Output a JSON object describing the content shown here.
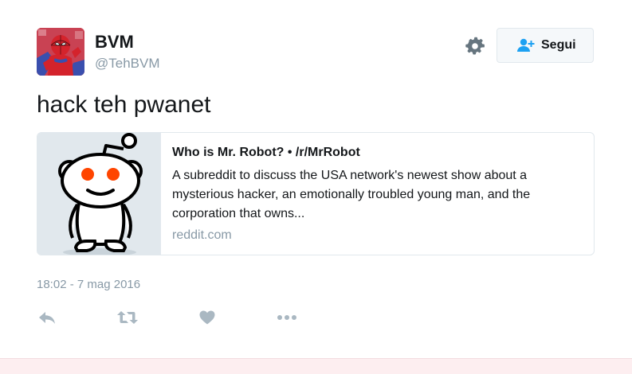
{
  "author": {
    "display_name": "BVM",
    "handle": "@TehBVM",
    "avatar_icon": "spiderman-avatar"
  },
  "header": {
    "settings_icon": "gear-icon",
    "follow_button": {
      "label": "Segui",
      "icon": "add-user-icon"
    }
  },
  "tweet": {
    "text": "hack teh pwanet",
    "timestamp": "18:02 - 7 mag 2016"
  },
  "card": {
    "image_icon": "reddit-alien-logo",
    "title": "Who is Mr. Robot? • /r/MrRobot",
    "description": "A subreddit to discuss the USA network's newest show about a mysterious hacker, an emotionally troubled young man, and the corporation that owns...",
    "domain": "reddit.com"
  },
  "actions": {
    "reply_icon": "reply-icon",
    "retweet_icon": "retweet-icon",
    "like_icon": "heart-icon",
    "more_icon": "more-dots-icon"
  },
  "colors": {
    "text_primary": "#14171a",
    "text_secondary": "#8899a6",
    "accent": "#1da1f2",
    "icon_gray": "#aab8c2",
    "card_border": "#e1e8ed",
    "reddit_orange": "#ff4500"
  }
}
